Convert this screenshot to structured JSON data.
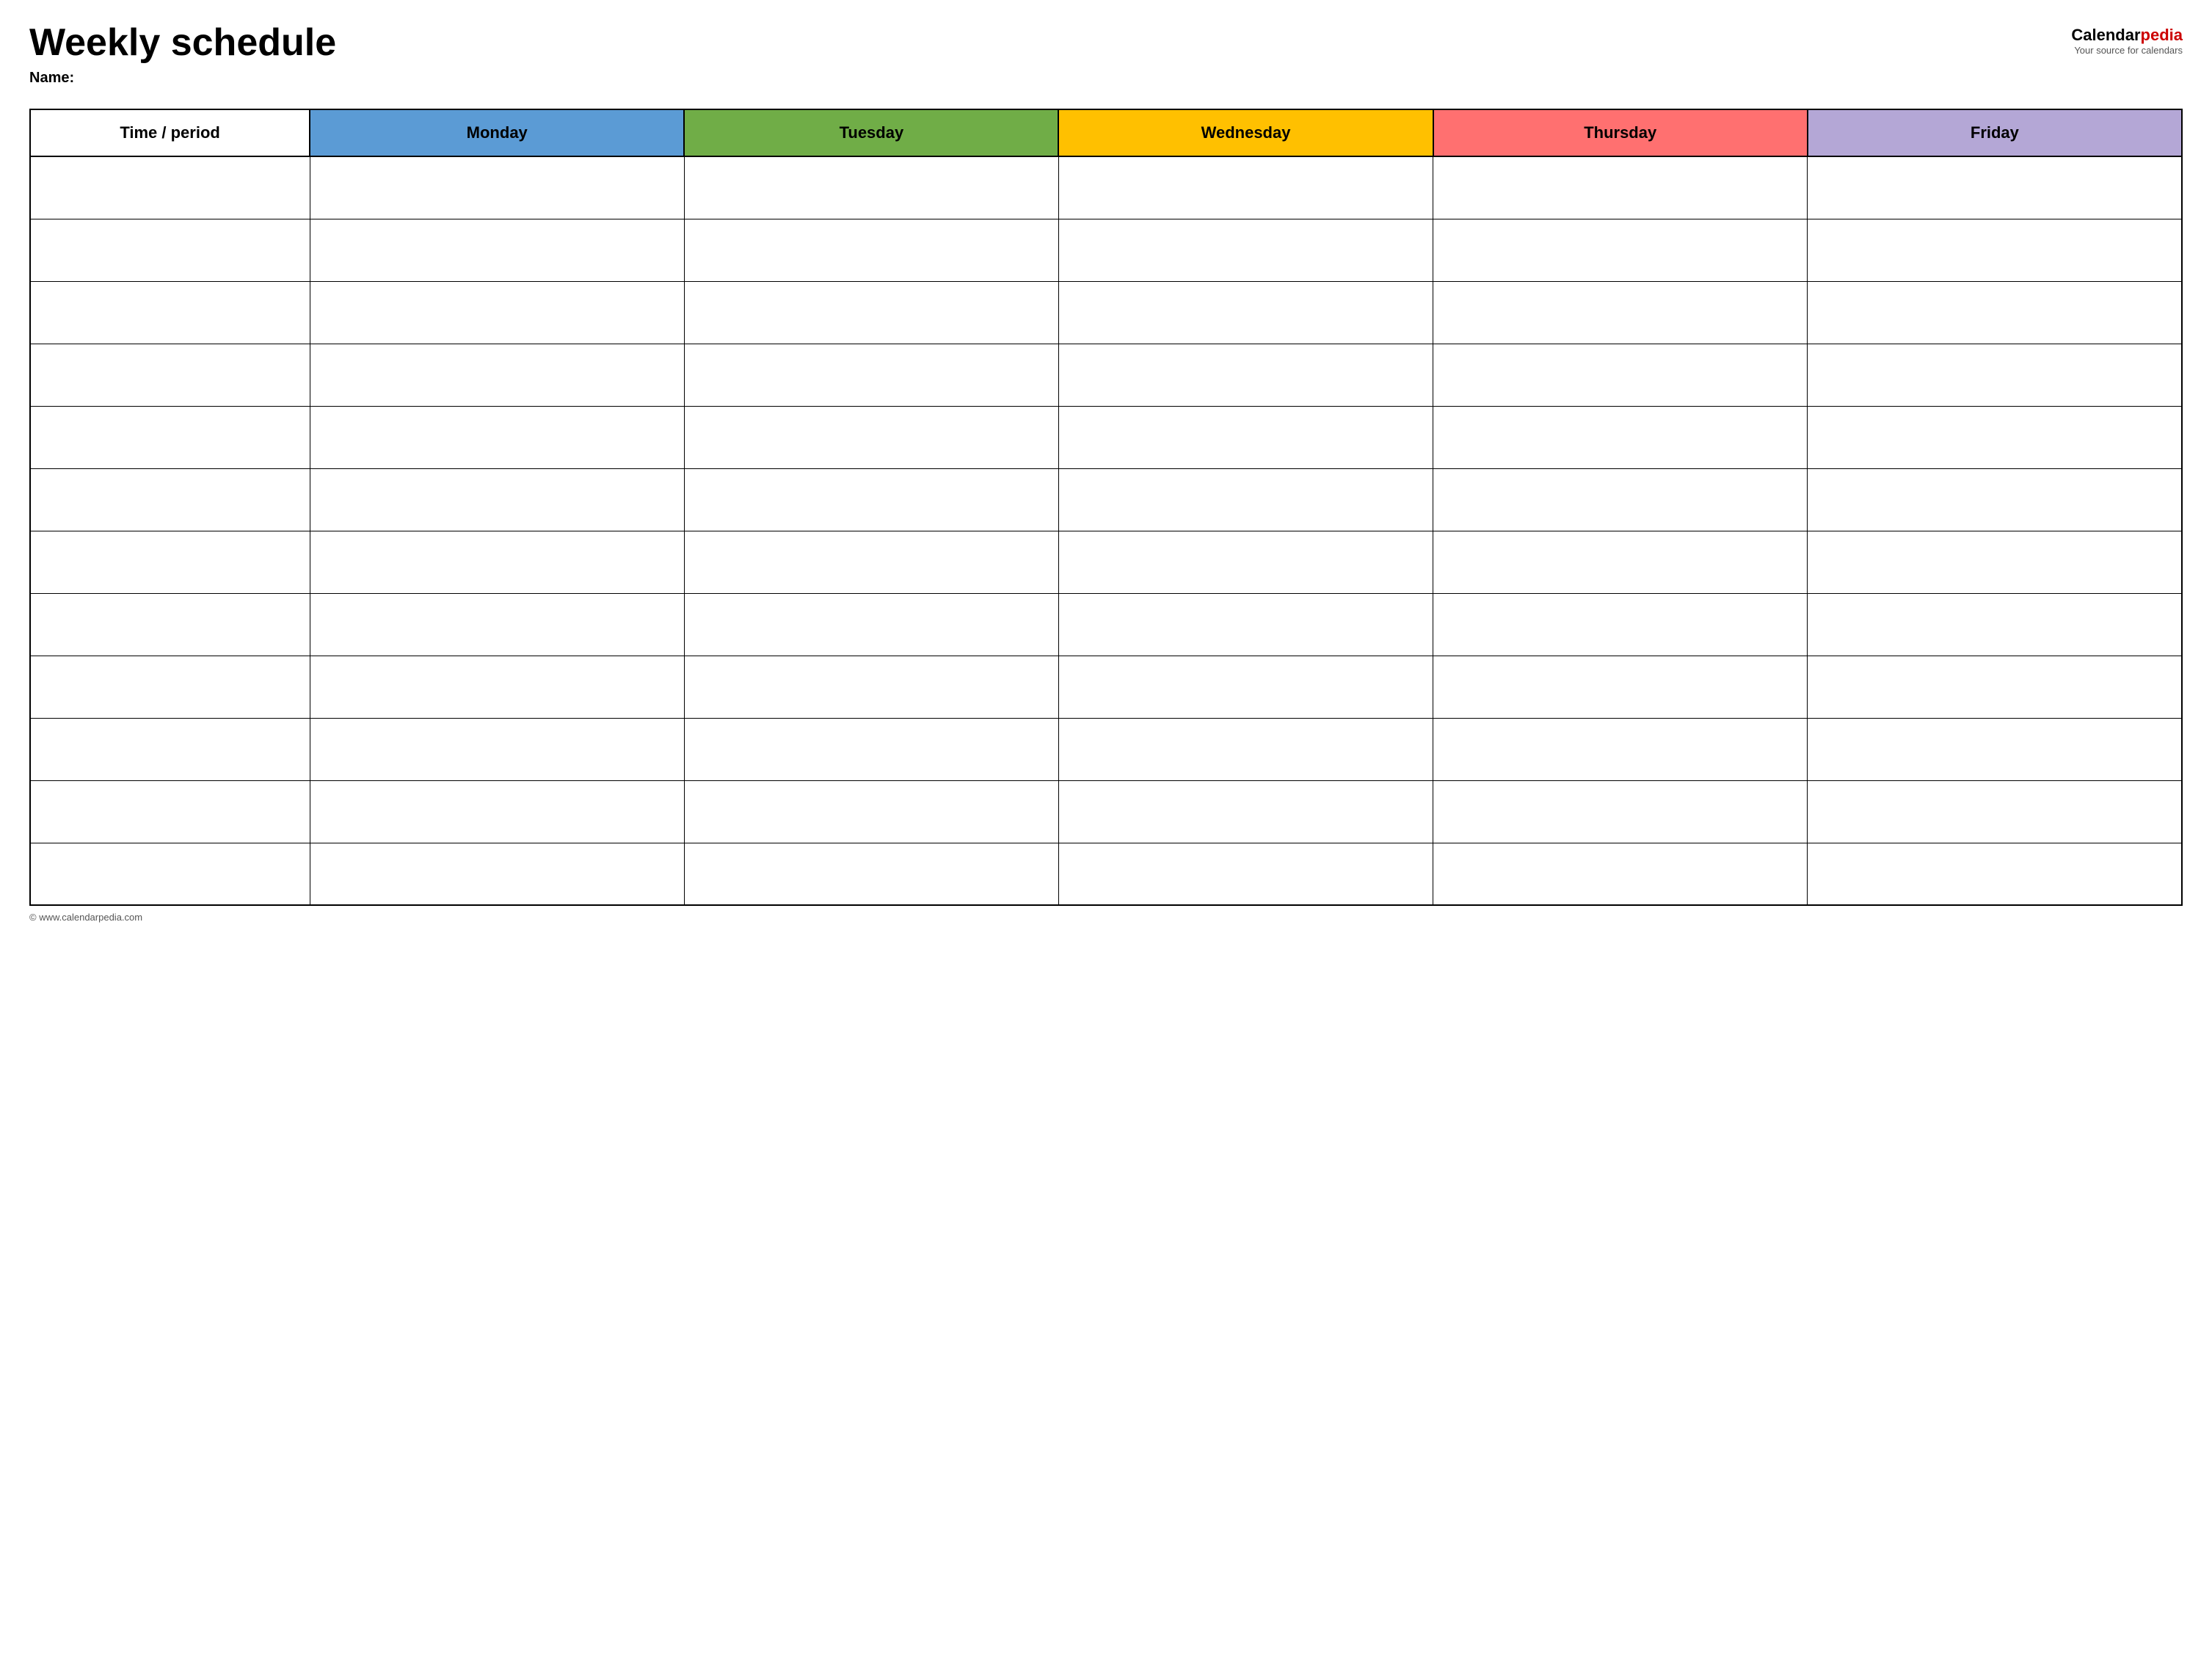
{
  "header": {
    "title": "Weekly schedule",
    "name_label": "Name:",
    "logo": {
      "name_part1": "Calendar",
      "name_part2": "pedia",
      "tagline": "Your source for calendars"
    }
  },
  "table": {
    "columns": [
      {
        "key": "time",
        "label": "Time / period",
        "color": "#ffffff",
        "class": "th-time"
      },
      {
        "key": "monday",
        "label": "Monday",
        "color": "#5b9bd5",
        "class": "th-monday"
      },
      {
        "key": "tuesday",
        "label": "Tuesday",
        "color": "#70ad47",
        "class": "th-tuesday"
      },
      {
        "key": "wednesday",
        "label": "Wednesday",
        "color": "#ffc000",
        "class": "th-wednesday"
      },
      {
        "key": "thursday",
        "label": "Thursday",
        "color": "#ff7070",
        "class": "th-thursday"
      },
      {
        "key": "friday",
        "label": "Friday",
        "color": "#b4a7d6",
        "class": "th-friday"
      }
    ],
    "row_count": 12
  },
  "footer": {
    "text": "© www.calendarpedia.com"
  }
}
